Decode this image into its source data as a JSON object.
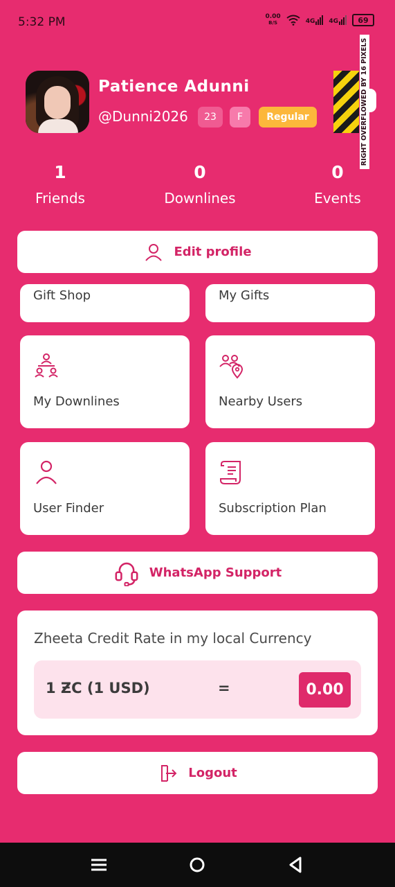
{
  "status_bar": {
    "time": "5:32 PM",
    "net_speed_value": "0.00",
    "net_speed_unit": "B/S",
    "signal_1": "4G",
    "signal_2": "4G",
    "battery": "69"
  },
  "profile": {
    "name": "Patience Adunni",
    "handle": "@Dunni2026",
    "age": "23",
    "gender": "F",
    "tier": "Regular"
  },
  "debug_overflow": "RIGHT OVERFLOWED BY 16 PIXELS",
  "stats": [
    {
      "value": "1",
      "label": "Friends"
    },
    {
      "value": "0",
      "label": "Downlines"
    },
    {
      "value": "0",
      "label": "Events"
    }
  ],
  "actions": {
    "edit_profile": "Edit profile",
    "whatsapp_support": "WhatsApp Support",
    "logout": "Logout"
  },
  "tiles": {
    "gift_shop": "Gift Shop",
    "my_gifts": "My Gifts",
    "my_downlines": "My Downlines",
    "nearby_users": "Nearby Users",
    "user_finder": "User Finder",
    "subscription_plan": "Subscription Plan"
  },
  "rate": {
    "title": "Zheeta Credit Rate in my local Currency",
    "left": "1 ƵC (1 USD)",
    "equals": "=",
    "value": "0.00"
  },
  "colors": {
    "brand": "#e72c6f",
    "accent_text": "#d32466",
    "rate_bg": "#fde2ec",
    "tier_chip": "#fcb73b"
  },
  "icons": {
    "edit": "user-icon",
    "whatsapp": "headset-icon",
    "logout": "logout-icon",
    "downlines": "hierarchy-icon",
    "nearby": "users-location-icon",
    "finder": "user-icon",
    "subscription": "receipt-icon"
  }
}
